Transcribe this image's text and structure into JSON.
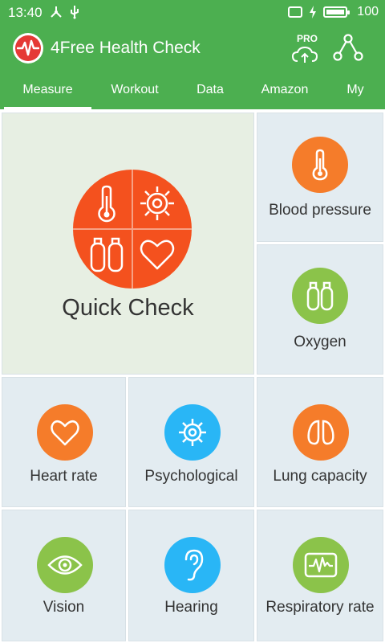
{
  "status": {
    "time": "13:40",
    "battery": "100"
  },
  "app": {
    "title": "4Free Health Check",
    "pro_label": "PRO"
  },
  "tabs": [
    {
      "label": "Measure"
    },
    {
      "label": "Workout"
    },
    {
      "label": "Data"
    },
    {
      "label": "Amazon"
    },
    {
      "label": "My"
    }
  ],
  "tiles": {
    "quick_check": "Quick Check",
    "blood_pressure": "Blood pressure",
    "oxygen": "Oxygen",
    "heart_rate": "Heart rate",
    "psychological": "Psychological",
    "lung_capacity": "Lung capacity",
    "vision": "Vision",
    "hearing": "Hearing",
    "respiratory_rate": "Respiratory rate"
  },
  "colors": {
    "primary": "#4caf50",
    "orange": "#f57c2a",
    "green": "#8bc34a",
    "cyan": "#29b6f6",
    "quick_circle": "#f4511e"
  }
}
